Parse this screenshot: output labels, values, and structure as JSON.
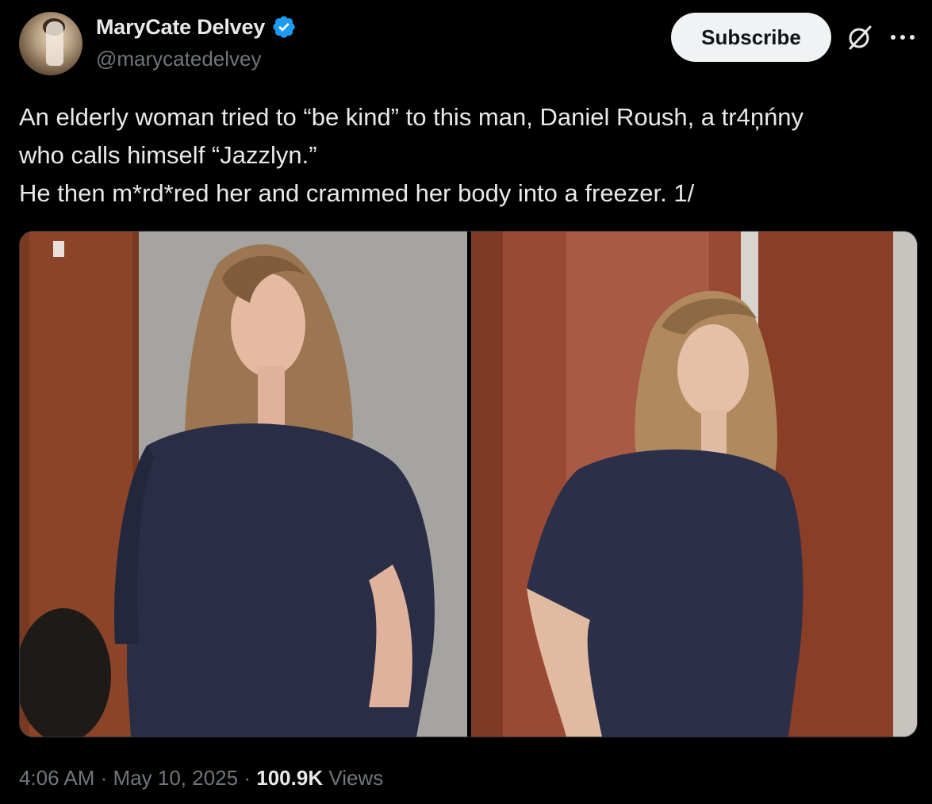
{
  "tweet": {
    "author": {
      "display_name": "MaryCate Delvey",
      "handle": "@marycatedelvey",
      "verified": true,
      "verified_color": "#1d9bf0"
    },
    "subscribe_label": "Subscribe",
    "icons": [
      "grok-icon",
      "more-icon"
    ],
    "text_lines": [
      "An elderly woman tried to “be kind” to this man, Daniel Roush, a tr4ņńny",
      "who calls himself “Jazzlyn.”",
      "He then m*rd*red her and crammed her body into a freezer. 1/"
    ],
    "media": {
      "count": 2
    },
    "footer": {
      "time": "4:06 AM",
      "separator": "·",
      "date": "May 10, 2025",
      "views_count": "100.9K",
      "views_label": "Views"
    }
  },
  "colors": {
    "background": "#000000",
    "text": "#e7e9ea",
    "secondary_text": "#71767b",
    "subscribe_bg": "#eff3f4"
  }
}
